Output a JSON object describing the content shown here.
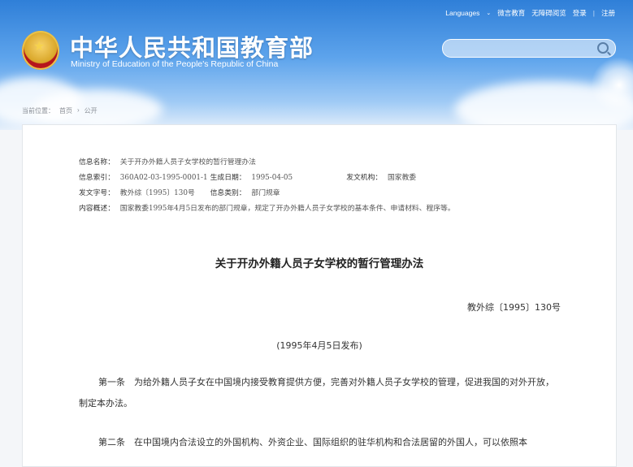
{
  "header": {
    "title": "中华人民共和国教育部",
    "subtitle": "Ministry of Education of the People's Republic of China",
    "nav": {
      "languages": "Languages",
      "weibo": "微言教育",
      "accessibility": "无障碍阅览",
      "login": "登录",
      "register": "注册"
    },
    "search": {
      "placeholder": ""
    }
  },
  "breadcrumb": {
    "prefix": "当前位置：",
    "home": "首页",
    "arrow": "›",
    "current": "公开"
  },
  "meta": {
    "name_label": "信息名称：",
    "name_value": "关于开办外籍人员子女学校的暂行管理办法",
    "index_label": "信息索引：",
    "index_value": "360A02-03-1995-0001-1",
    "date_label": "生成日期：",
    "date_value": "1995-04-05",
    "agency_label": "发文机构：",
    "agency_value": "国家教委",
    "docno_label": "发文字号：",
    "docno_value": "教外综〔1995〕130号",
    "category_label": "信息类别：",
    "category_value": "部门规章",
    "summary_label": "内容概述：",
    "summary_value": "国家教委1995年4月5日发布的部门规章，规定了开办外籍人员子女学校的基本条件、申请材料、程序等。"
  },
  "document": {
    "title": "关于开办外籍人员子女学校的暂行管理办法",
    "number": "教外综〔1995〕130号",
    "published": "(1995年4月5日发布)",
    "para1": "第一条　为给外籍人员子女在中国境内接受教育提供方便，完善对外籍人员子女学校的管理，促进我国的对外开放，制定本办法。",
    "para2": "第二条　在中国境内合法设立的外国机构、外资企业、国际组织的驻华机构和合法居留的外国人，可以依照本"
  }
}
